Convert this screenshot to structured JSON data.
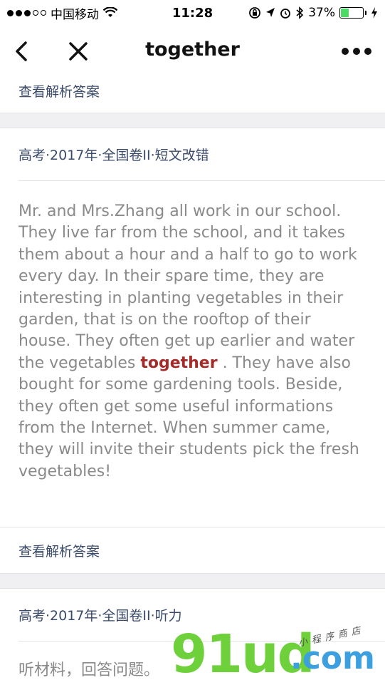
{
  "status_bar": {
    "carrier": "中国移动",
    "time": "11:28",
    "battery_percent": "37%",
    "battery_level": 0.37,
    "battery_color": "#4cd964"
  },
  "nav": {
    "title": "together",
    "back_icon": "chevron-left-icon",
    "close_icon": "close-icon",
    "more_icon": "more-dots-icon"
  },
  "top_link": "查看解析答案",
  "card1": {
    "source": "高考·2017年·全国卷II·短文改错",
    "passage_before": "Mr. and Mrs.Zhang all work in our school. They live far from the school, and it takes them about a hour and a half to go to work every day. In their spare time, they are interesting in planting vegetables in their garden, that is on the rooftop of their house. They often get up earlier and water the vegetables ",
    "highlight": "together",
    "passage_after": " . They have also bought for some gardening tools. Beside, they often get some useful informations from the Internet. When summer came, they will invite their students pick the fresh vegetables!",
    "answer_link": "查看解析答案"
  },
  "card2": {
    "source": "高考·2017年·全国卷II·听力",
    "prompt": "听材料，回答问题。"
  },
  "watermark": {
    "big": "91ud",
    "com": ".com",
    "small": "小程序商店"
  },
  "colors": {
    "link_text": "#3a4a6a",
    "passage_text": "#8a8a8a",
    "highlight": "#a52a2a",
    "separator_bg": "#f0f0f3"
  }
}
